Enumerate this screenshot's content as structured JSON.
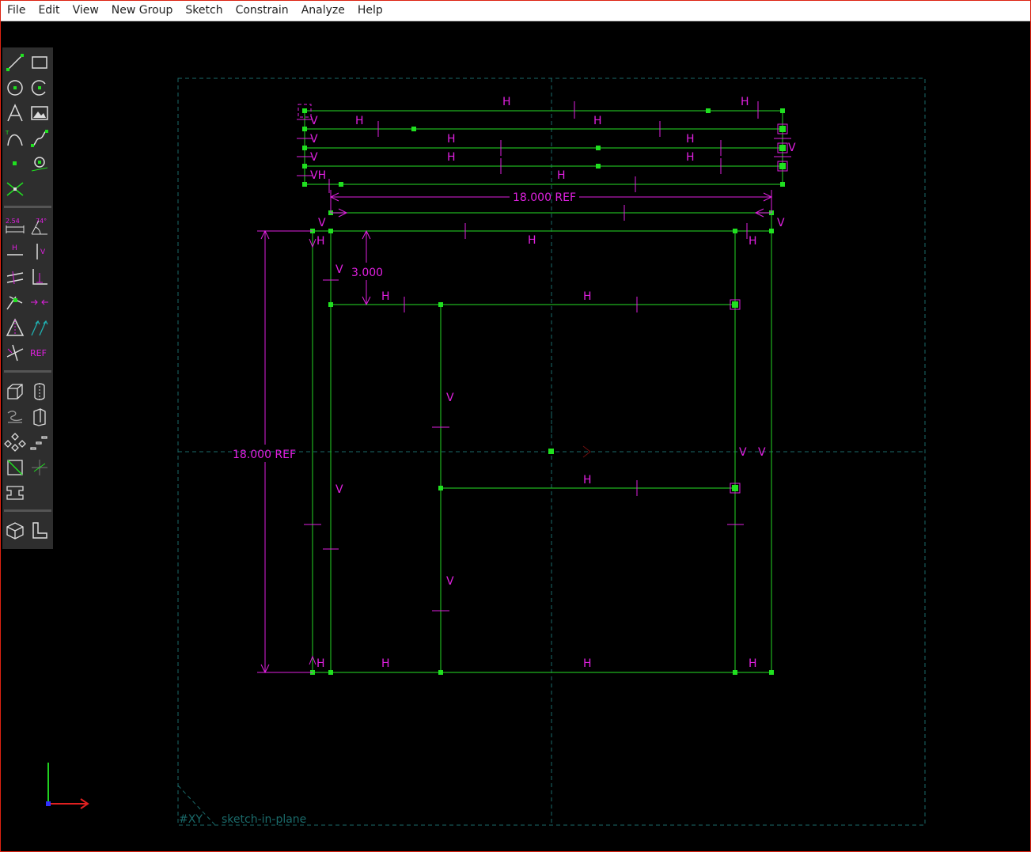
{
  "menubar": {
    "items": [
      "File",
      "Edit",
      "View",
      "New Group",
      "Sketch",
      "Constrain",
      "Analyze",
      "Help"
    ]
  },
  "toolbar": {
    "tools": [
      {
        "name": "line-icon"
      },
      {
        "name": "rectangle-icon"
      },
      {
        "name": "circle-icon"
      },
      {
        "name": "arc-icon"
      },
      {
        "name": "text-icon"
      },
      {
        "name": "image-icon"
      },
      {
        "name": "tangent-arc-icon"
      },
      {
        "name": "cubic-spline-icon"
      },
      {
        "name": "datum-point-icon"
      },
      {
        "name": "workplane-icon"
      },
      {
        "name": "split-curves-icon"
      },
      {
        "name": "distance-dimension-icon",
        "label": "2.54"
      },
      {
        "name": "angle-dimension-icon",
        "label": "74°"
      },
      {
        "name": "horizontal-constraint-icon",
        "label": "H"
      },
      {
        "name": "vertical-constraint-icon",
        "label": "V"
      },
      {
        "name": "parallel-constraint-icon"
      },
      {
        "name": "perpendicular-constraint-icon"
      },
      {
        "name": "on-point-constraint-icon"
      },
      {
        "name": "midpoint-constraint-icon"
      },
      {
        "name": "symmetric-constraint-icon"
      },
      {
        "name": "same-orientation-icon"
      },
      {
        "name": "other-supplementary-icon"
      },
      {
        "name": "reference-toggle-icon",
        "label": "REF"
      },
      {
        "name": "extrude-icon"
      },
      {
        "name": "lathe-icon"
      },
      {
        "name": "helix-icon"
      },
      {
        "name": "revolve-icon"
      },
      {
        "name": "step-rotating-icon"
      },
      {
        "name": "step-translating-icon"
      },
      {
        "name": "in-3d-workplane-icon"
      },
      {
        "name": "new-workplane-icon"
      },
      {
        "name": "link-import-icon"
      },
      {
        "name": "isometric-view-icon"
      },
      {
        "name": "workplane-view-icon"
      }
    ]
  },
  "sketch": {
    "dimensions": {
      "top_width": "18.000  REF",
      "left_height": "18.000  REF",
      "offset": "3.000"
    },
    "workplane_label": "#XY",
    "group_label": "sketch-in-plane",
    "constraint_h": "H",
    "constraint_v": "V",
    "constraint_vh": "VH",
    "colors": {
      "geometry": "#1fb21f",
      "point": "#20e020",
      "constraint": "#e020e0",
      "workplane": "#1a6a6a",
      "axis_x": "#e02020",
      "axis_y": "#20d020",
      "axis_z": "#3030ff",
      "bg": "#000000"
    }
  }
}
